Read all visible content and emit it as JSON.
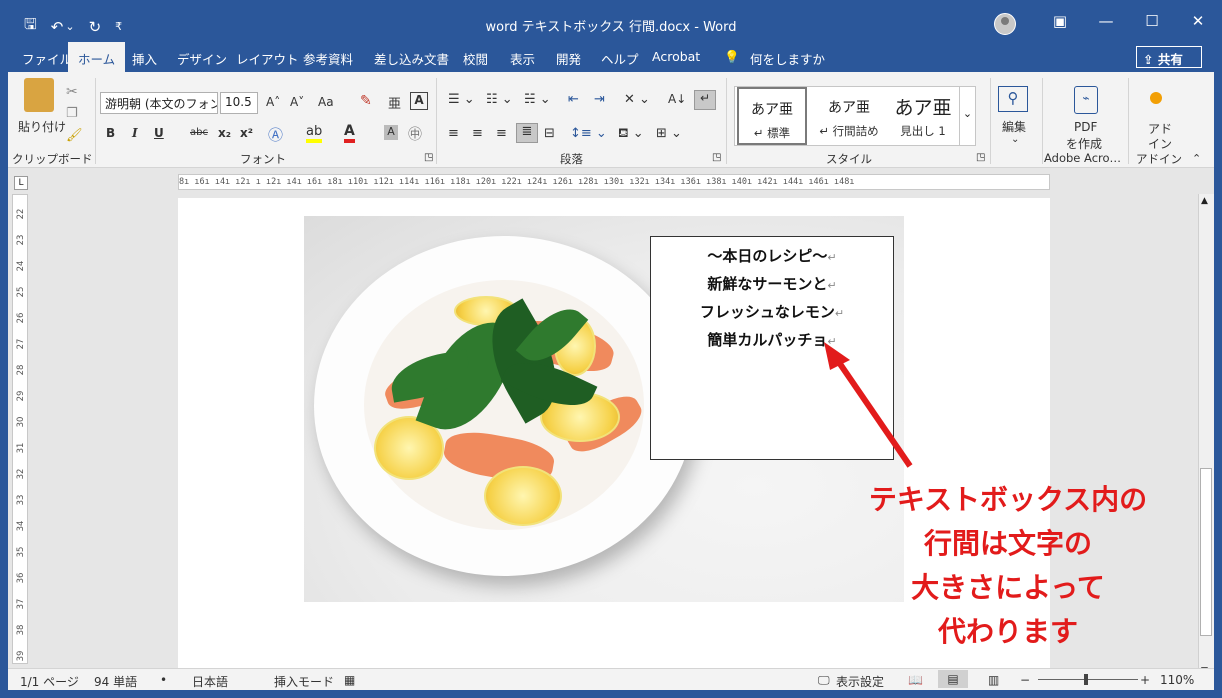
{
  "titlebar": {
    "title": "word テキストボックス 行間.docx  -  Word",
    "qat": {
      "save": "🖫",
      "undo": "↶",
      "undo_dd": "⌄",
      "redo": "↻",
      "customize": "₹"
    },
    "controls": {
      "ribbon_options": "▣",
      "minimize": "—",
      "maximize": "☐",
      "close": "✕"
    }
  },
  "tabs": [
    "ファイル",
    "ホーム",
    "挿入",
    "デザイン",
    "レイアウト",
    "参考資料",
    "差し込み文書",
    "校閲",
    "表示",
    "開発",
    "ヘルプ",
    "Acrobat"
  ],
  "active_tab": "ホーム",
  "tell_me": "何をしますか",
  "share": "共有",
  "ribbon": {
    "clipboard": {
      "paste": "貼り付け",
      "label": "クリップボード"
    },
    "font": {
      "font_name": "游明朝 (本文のフォン",
      "font_size": "10.5",
      "grow": "A˄",
      "shrink": "A˅",
      "case": "Aa",
      "bold": "B",
      "italic": "I",
      "underline": "U",
      "strike": "abc",
      "sub": "x₂",
      "sup": "x²",
      "label": "フォント"
    },
    "paragraph": {
      "label": "段落"
    },
    "styles": {
      "items": [
        {
          "preview": "あア亜",
          "name": "↵ 標準"
        },
        {
          "preview": "あア亜",
          "name": "↵ 行間詰め"
        },
        {
          "preview": "あア亜",
          "name": "見出し 1"
        }
      ],
      "label": "スタイル"
    },
    "editing": {
      "label": "編集"
    },
    "pdf": {
      "line1": "PDF",
      "line2": "を作成",
      "group": "Adobe Acro…"
    },
    "addin": {
      "line1": "アド",
      "line2": "イン",
      "group": "アドイン"
    }
  },
  "ruler_h": "8ı ı6ı ı4ı ı2ı  ı   ı2ı ı4ı ı6ı ı8ı ı10ı ı12ı ı14ı ı16ı ı18ı ı20ı ı22ı ı24ı ı26ı ı28ı ı30ı ı32ı ı34ı ı36ı ı38ı ı40ı ı42ı ı44ı ı46ı ı48ı",
  "ruler_v": [
    "22",
    "23",
    "24",
    "25",
    "26",
    "27",
    "28",
    "29",
    "30",
    "31",
    "32",
    "33",
    "34",
    "35",
    "36",
    "37",
    "38",
    "39"
  ],
  "ruler_corner": "L",
  "textbox": {
    "lines": [
      "～本日のレシピ～",
      "新鮮なサーモンと",
      "フレッシュなレモン",
      "簡単カルパッチョ"
    ],
    "return_mark": "↵"
  },
  "annotation": {
    "lines": [
      "テキストボックス内の",
      "行間は文字の",
      "大きさによって",
      "代わります"
    ],
    "color": "#e21b1b"
  },
  "statusbar": {
    "page": "1/1 ページ",
    "words": "94 単語",
    "proof": "•",
    "language": "日本語",
    "mode": "挿入モード",
    "display_settings": "表示設定",
    "zoom_minus": "−",
    "zoom_plus": "+",
    "zoom": "110%"
  }
}
